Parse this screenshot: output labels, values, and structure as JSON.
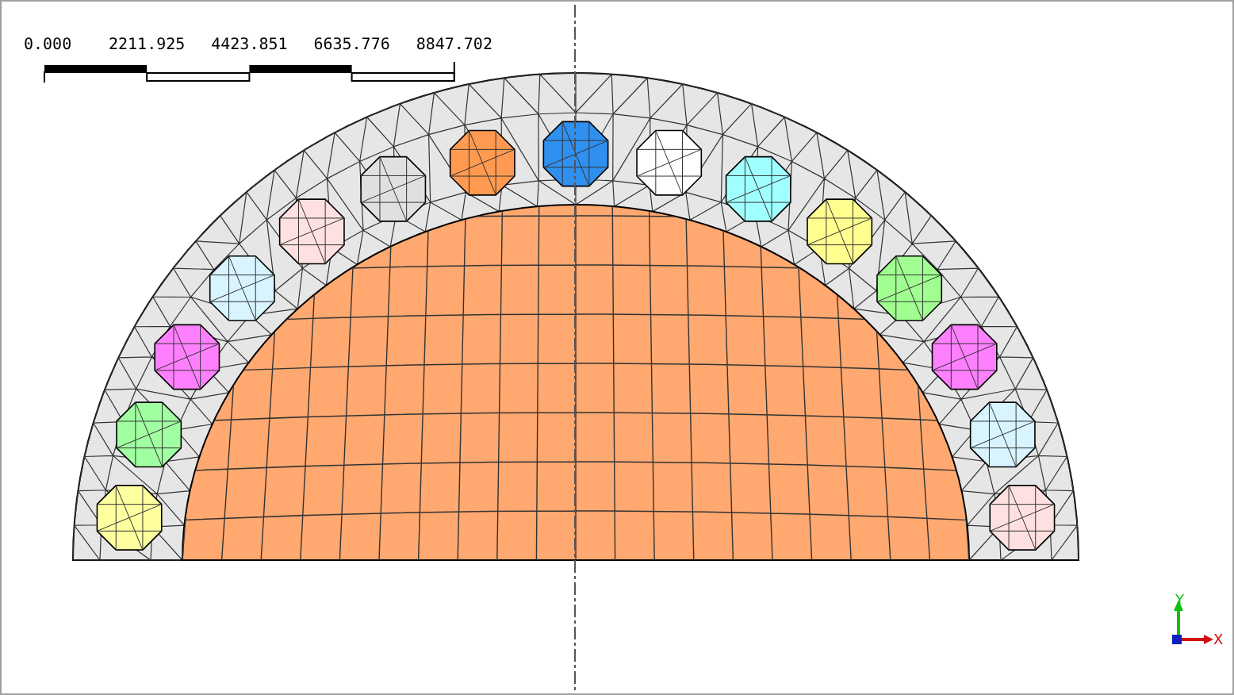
{
  "scale_bar": {
    "ticks": [
      "0.000",
      "2211.925",
      "4423.851",
      "6635.776",
      "8847.702"
    ]
  },
  "conductors": [
    {
      "color": "#ffffa0"
    },
    {
      "color": "#a0ffa0"
    },
    {
      "color": "#ff80ff"
    },
    {
      "color": "#d8f4ff"
    },
    {
      "color": "#ffe0e0"
    },
    {
      "color": "#e0e0e0"
    },
    {
      "color": "#ff9a50"
    },
    {
      "color": "#3090f0"
    },
    {
      "color": "#ffffff"
    },
    {
      "color": "#a0ffff"
    },
    {
      "color": "#ffff90"
    },
    {
      "color": "#a0ff90"
    },
    {
      "color": "#ff80ff"
    },
    {
      "color": "#d8f4ff"
    },
    {
      "color": "#ffe0e0"
    }
  ],
  "axes": {
    "x": "X",
    "y": "Y"
  }
}
